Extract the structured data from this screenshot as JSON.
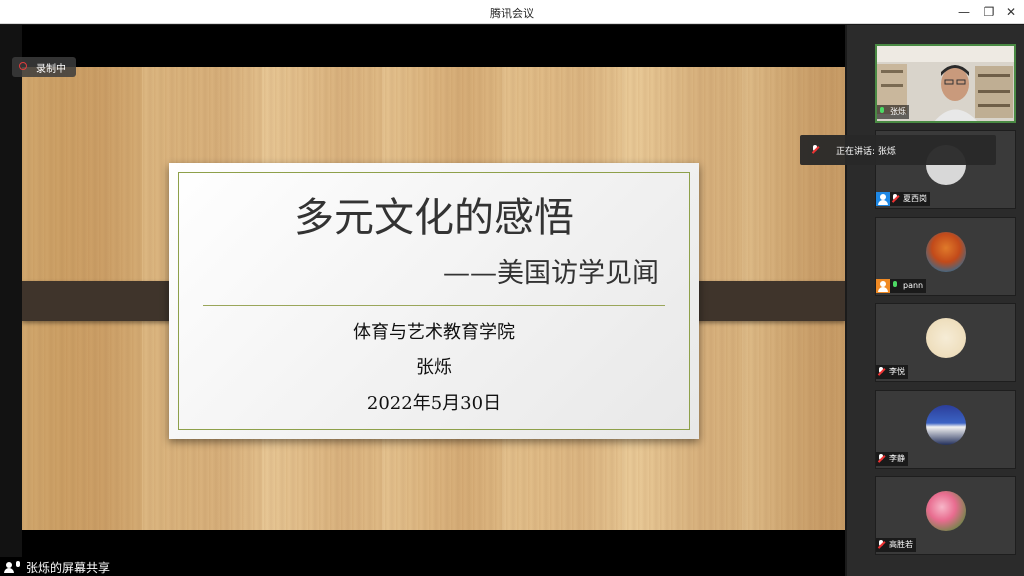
{
  "window": {
    "title": "腾讯会议"
  },
  "recording": {
    "label": "录制中"
  },
  "slide": {
    "title": "多元文化的感悟",
    "subtitle": "——美国访学见闻",
    "college": "体育与艺术教育学院",
    "author": "张烁",
    "date": "2022年5月30日"
  },
  "speaking": {
    "label": "正在讲话: 张烁"
  },
  "participants": [
    {
      "name": "张烁",
      "mic": "on"
    },
    {
      "name": "夏西岗",
      "mic": "muted"
    },
    {
      "name": "pann",
      "mic": "on"
    },
    {
      "name": "李悦",
      "mic": "muted"
    },
    {
      "name": "李静",
      "mic": "muted"
    },
    {
      "name": "高胜若",
      "mic": "muted"
    }
  ],
  "bottom": {
    "share_label": "张烁的屏幕共享"
  }
}
